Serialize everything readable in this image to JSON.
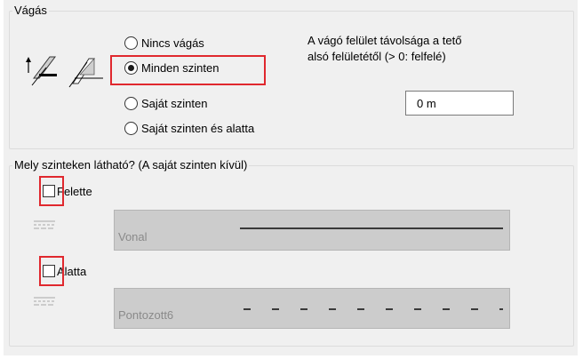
{
  "vagas": {
    "legend": "Vágás",
    "options": [
      {
        "label": "Nincs vágás",
        "checked": false
      },
      {
        "label": "Minden szinten",
        "checked": true
      },
      {
        "label": "Saját szinten",
        "checked": false
      },
      {
        "label": "Saját szinten és alatta",
        "checked": false
      }
    ],
    "distance_label_line1": "A vágó felület távolsága a tető",
    "distance_label_line2": "alsó felületétől (> 0: felfelé)",
    "distance_value": "0 m"
  },
  "visibility": {
    "legend": "Mely szinteken látható? (A saját szinten kívül)",
    "above": {
      "label": "Felette",
      "checked": false,
      "line_type": "Vonal"
    },
    "below": {
      "label": "Alatta",
      "checked": false,
      "line_type": "Pontozott6"
    }
  },
  "colors": {
    "highlight": "#e0282e",
    "panel_bg": "#f0f0f0",
    "combo_bg": "#cccccc"
  }
}
